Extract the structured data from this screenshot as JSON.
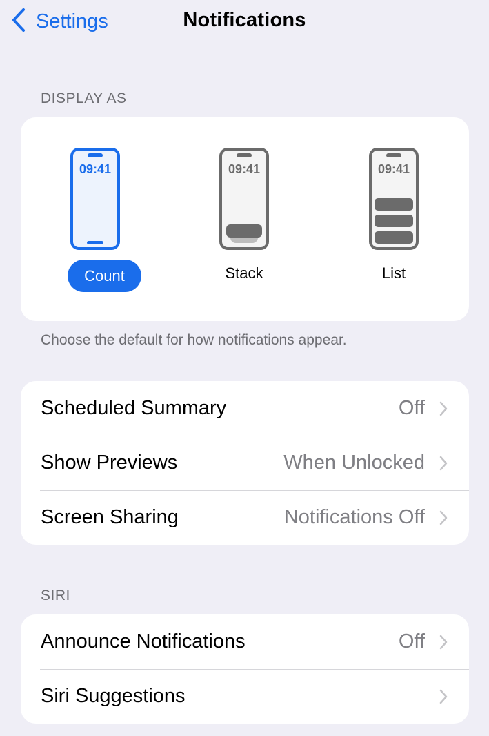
{
  "navbar": {
    "back_label": "Settings",
    "back_icon": "chevron-left-icon",
    "title": "Notifications"
  },
  "display_as": {
    "header": "DISPLAY AS",
    "options": [
      {
        "label": "Count",
        "clock": "09:41",
        "selected": true
      },
      {
        "label": "Stack",
        "clock": "09:41",
        "selected": false
      },
      {
        "label": "List",
        "clock": "09:41",
        "selected": false
      }
    ],
    "footer": "Choose the default for how notifications appear."
  },
  "general": {
    "rows": [
      {
        "label": "Scheduled Summary",
        "value": "Off"
      },
      {
        "label": "Show Previews",
        "value": "When Unlocked"
      },
      {
        "label": "Screen Sharing",
        "value": "Notifications Off"
      }
    ]
  },
  "siri": {
    "header": "SIRI",
    "rows": [
      {
        "label": "Announce Notifications",
        "value": "Off"
      },
      {
        "label": "Siri Suggestions",
        "value": ""
      }
    ]
  },
  "colors": {
    "accent": "#1A6DEB",
    "background": "#EFEEF6",
    "secondary_text": "#7F7F84",
    "chevron": "#C4C4C7"
  }
}
